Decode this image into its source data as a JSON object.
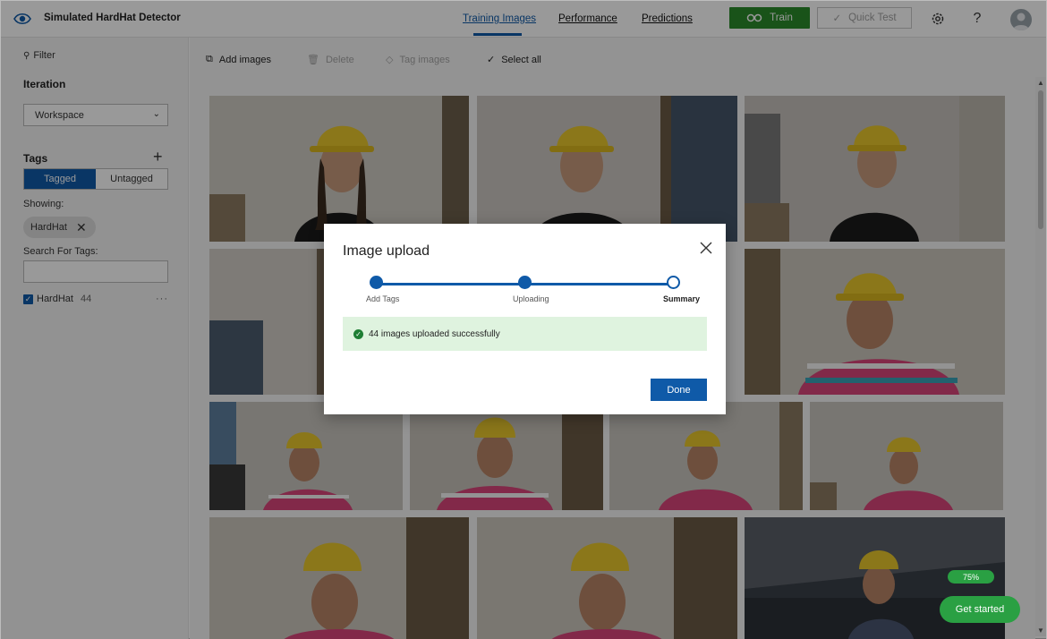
{
  "app": {
    "title": "Simulated HardHat Detector"
  },
  "nav": {
    "tabs": [
      {
        "label": "Training Images"
      },
      {
        "label": "Performance"
      },
      {
        "label": "Predictions"
      }
    ]
  },
  "header": {
    "train_label": "Train",
    "quick_test_label": "Quick Test"
  },
  "sidebar": {
    "filter_label": "Filter",
    "iteration_label": "Iteration",
    "iteration_value": "Workspace",
    "tags_label": "Tags",
    "tagged_label": "Tagged",
    "untagged_label": "Untagged",
    "showing_label": "Showing:",
    "showing_chip": "HardHat",
    "search_label": "Search For Tags:",
    "tag_list": [
      {
        "name": "HardHat",
        "count": "44"
      }
    ]
  },
  "toolbar": {
    "add": "Add images",
    "delete": "Delete",
    "tag": "Tag images",
    "select_all": "Select all"
  },
  "dialog": {
    "title": "Image upload",
    "steps": [
      "Add Tags",
      "Uploading",
      "Summary"
    ],
    "message": "44 images uploaded successfully",
    "done_label": "Done"
  },
  "get_started": {
    "progress": "75%",
    "label": "Get started"
  },
  "colors": {
    "accent": "#0f5aa8",
    "train": "#2a8a2a",
    "success_bg": "#dff3df",
    "get_started": "#2aa043"
  }
}
